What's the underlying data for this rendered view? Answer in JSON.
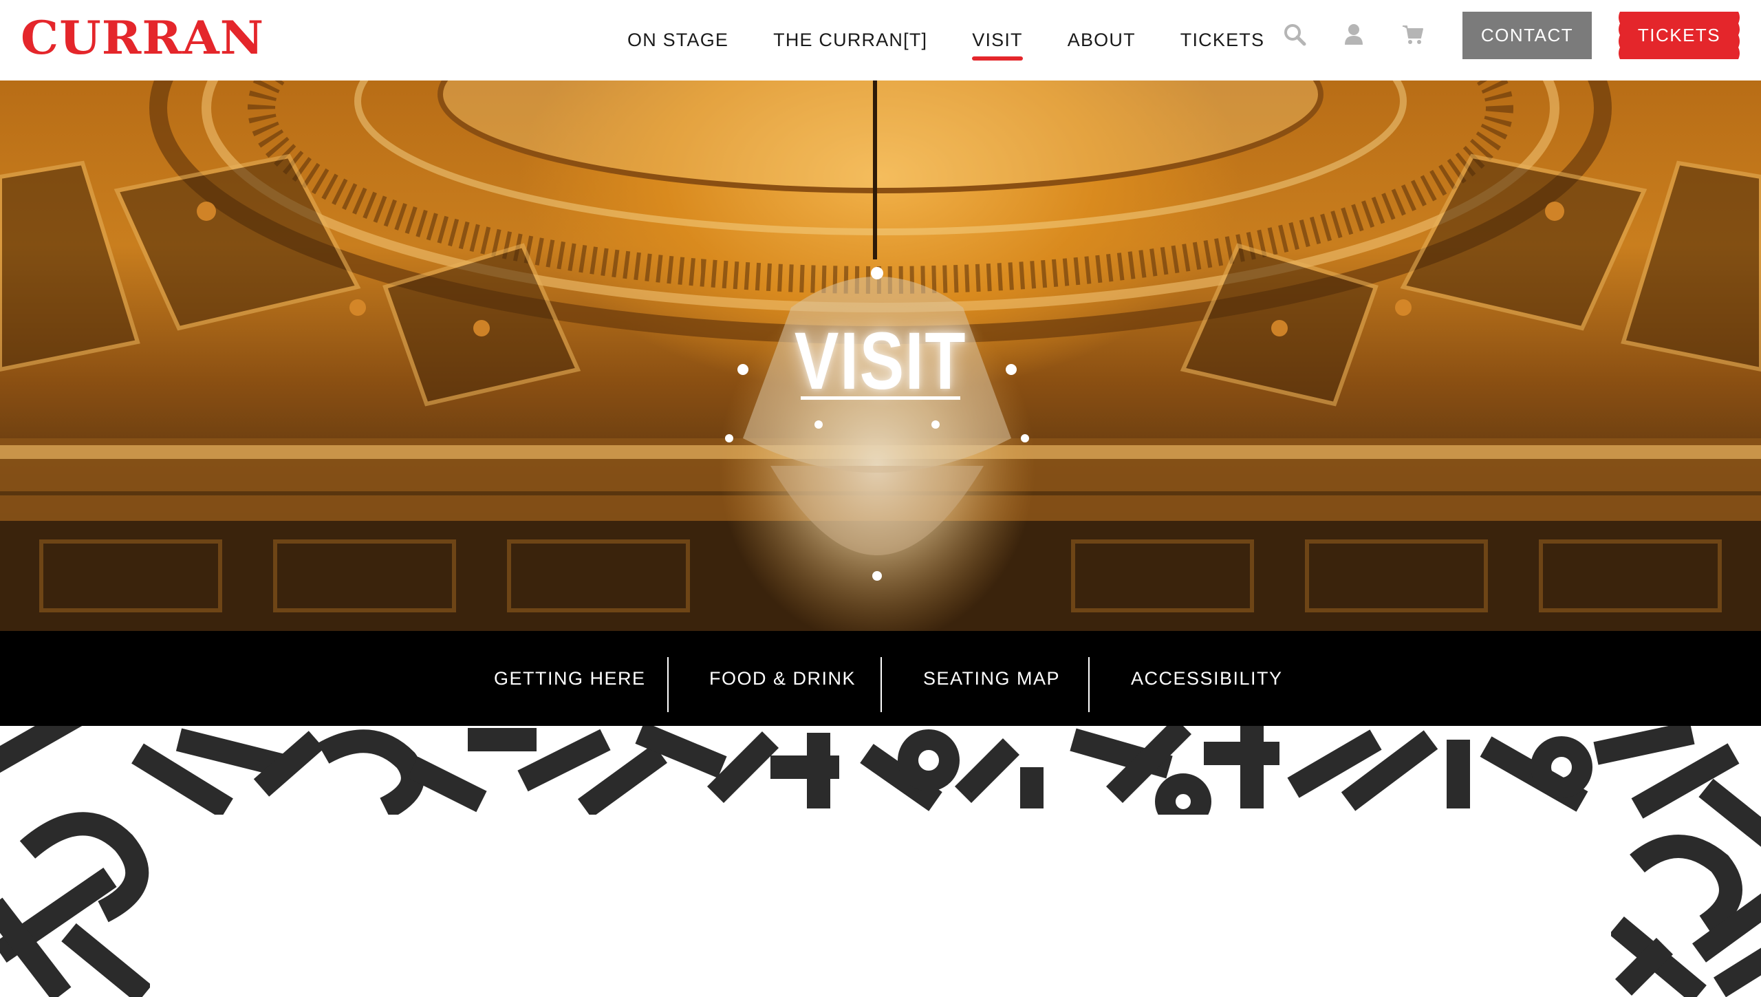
{
  "header": {
    "logo": "CURRAN",
    "nav": [
      {
        "label": "ON STAGE",
        "active": false
      },
      {
        "label": "THE CURRAN[T]",
        "active": false
      },
      {
        "label": "VISIT",
        "active": true
      },
      {
        "label": "ABOUT",
        "active": false
      },
      {
        "label": "TICKETS",
        "active": false
      }
    ],
    "icons": [
      "search-icon",
      "user-icon",
      "cart-icon"
    ],
    "contact_label": "CONTACT",
    "tickets_label": "TICKETS"
  },
  "hero": {
    "title": "VISIT"
  },
  "subnav": {
    "items": [
      "GETTING HERE",
      "FOOD & DRINK",
      "SEATING MAP",
      "ACCESSIBILITY"
    ]
  },
  "colors": {
    "brand_red": "#e4262b",
    "contact_gray": "#7b7b7b",
    "subnav_bg": "#000000"
  }
}
